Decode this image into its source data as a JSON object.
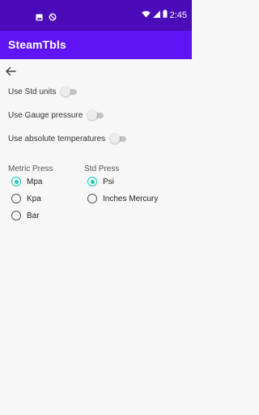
{
  "status_bar": {
    "time": "2:45",
    "icons": [
      "image-icon",
      "data-saver-icon",
      "wifi-icon",
      "signal-icon",
      "battery-icon"
    ]
  },
  "app_bar": {
    "title": "SteamTbls"
  },
  "settings": {
    "std_units_label": "Use Std units",
    "gauge_pressure_label": "Use Gauge pressure",
    "absolute_temps_label": "Use absolute temperatures",
    "std_units_on": false,
    "gauge_pressure_on": false,
    "absolute_temps_on": false
  },
  "metric_press": {
    "label": "Metric Press",
    "options": [
      "Mpa",
      "Kpa",
      "Bar"
    ],
    "selected": "Mpa"
  },
  "std_press": {
    "label": "Std Press",
    "options": [
      "Psi",
      "Inches Mercury"
    ],
    "selected": "Psi"
  },
  "colors": {
    "status_bar": "#4a0bb8",
    "app_bar": "#5e14f5",
    "accent": "#1ccbb8"
  }
}
